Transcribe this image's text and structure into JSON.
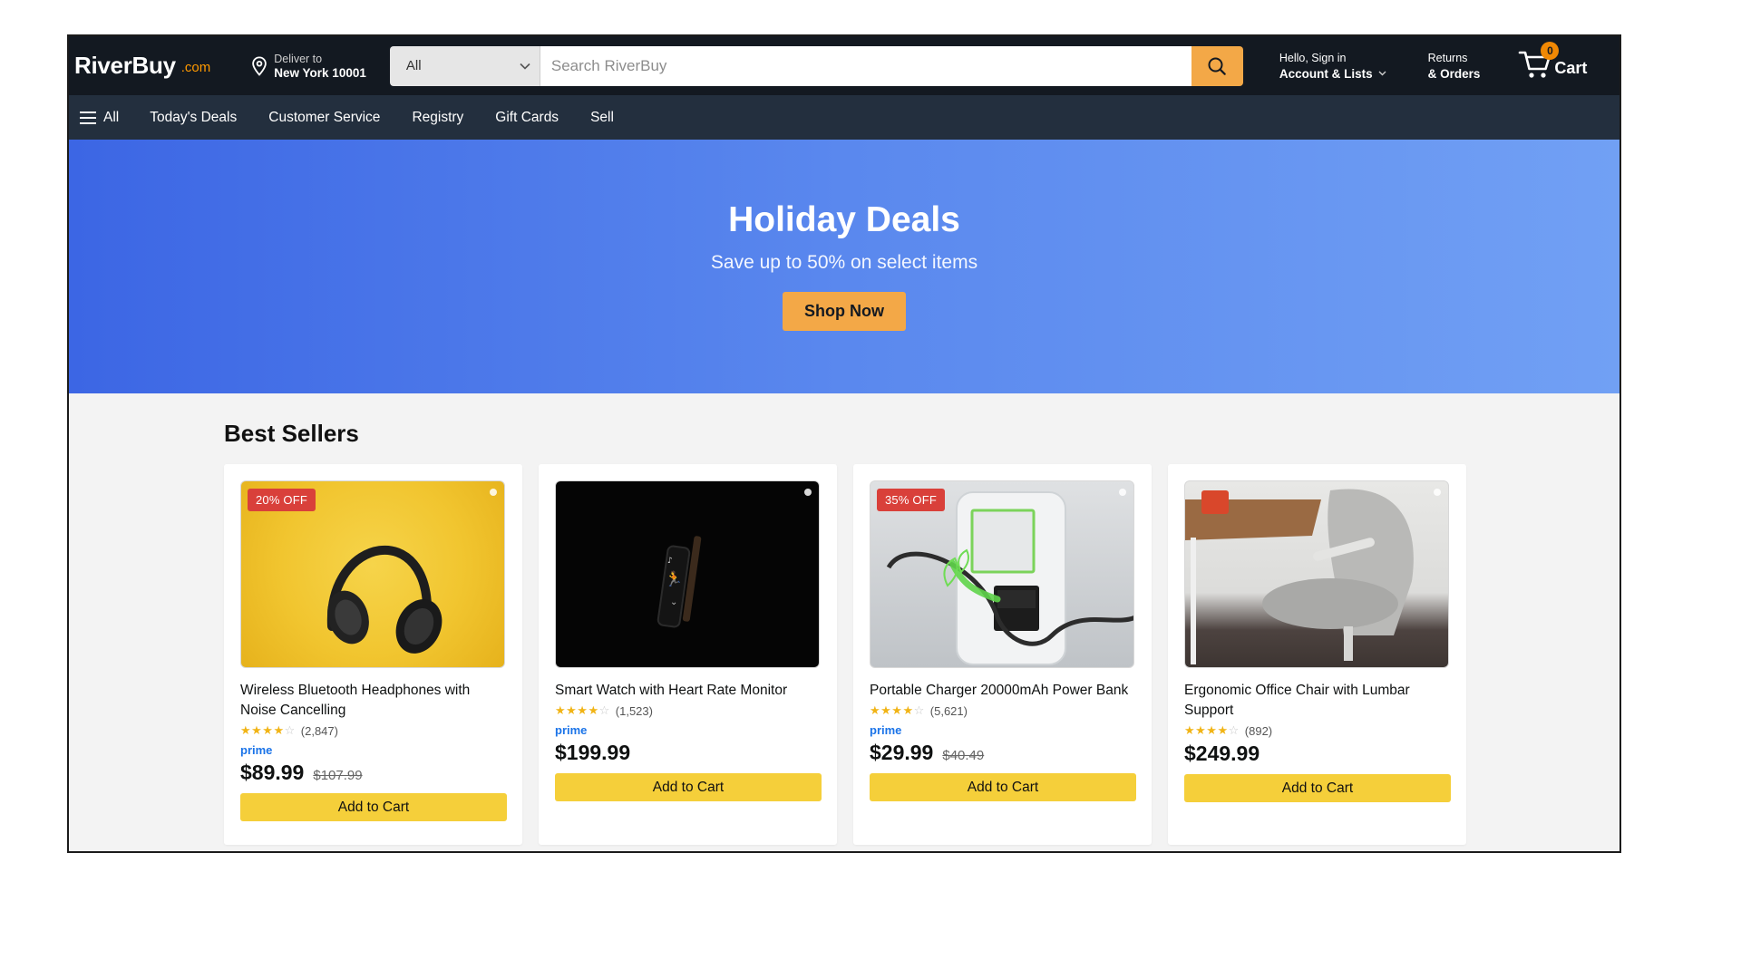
{
  "header": {
    "logo_main": "RiverBuy",
    "logo_suffix": ".com",
    "deliver_label": "Deliver to",
    "deliver_location": "New York 10001",
    "search_category": "All",
    "search_placeholder": "Search RiverBuy",
    "account_greeting": "Hello, Sign in",
    "account_label": "Account & Lists",
    "returns_line1": "Returns",
    "returns_line2": "& Orders",
    "cart_count": "0",
    "cart_label": "Cart"
  },
  "nav": {
    "all_label": "All",
    "items": [
      "Today's Deals",
      "Customer Service",
      "Registry",
      "Gift Cards",
      "Sell"
    ]
  },
  "hero": {
    "title": "Holiday Deals",
    "subtitle": "Save up to 50% on select items",
    "button": "Shop Now"
  },
  "best_sellers": {
    "title": "Best Sellers",
    "products": [
      {
        "name": "Wireless Bluetooth Headphones with Noise Cancelling",
        "badge": "20% OFF",
        "rating_count": "(2,847)",
        "prime": "prime",
        "price": "$89.99",
        "old_price": "$107.99",
        "button": "Add to Cart",
        "stars": 4
      },
      {
        "name": "Smart Watch with Heart Rate Monitor",
        "badge": "",
        "rating_count": "(1,523)",
        "prime": "prime",
        "price": "$199.99",
        "old_price": "",
        "button": "Add to Cart",
        "stars": 4
      },
      {
        "name": "Portable Charger 20000mAh Power Bank",
        "badge": "35% OFF",
        "rating_count": "(5,621)",
        "prime": "prime",
        "price": "$29.99",
        "old_price": "$40.49",
        "button": "Add to Cart",
        "stars": 4
      },
      {
        "name": "Ergonomic Office Chair with Lumbar Support",
        "badge": "",
        "rating_count": "(892)",
        "prime": "",
        "price": "$249.99",
        "old_price": "",
        "button": "Add to Cart",
        "stars": 4
      }
    ]
  },
  "colors": {
    "header_bg": "#131921",
    "nav_bg": "#232f3e",
    "accent_orange": "#f3a847",
    "add_to_cart": "#f5cf3a",
    "badge_red": "#d9403a",
    "prime_blue": "#1a73e8"
  },
  "icons": [
    "location-pin-icon",
    "chevron-down-icon",
    "search-icon",
    "cart-icon",
    "hamburger-menu-icon",
    "star-icon"
  ]
}
